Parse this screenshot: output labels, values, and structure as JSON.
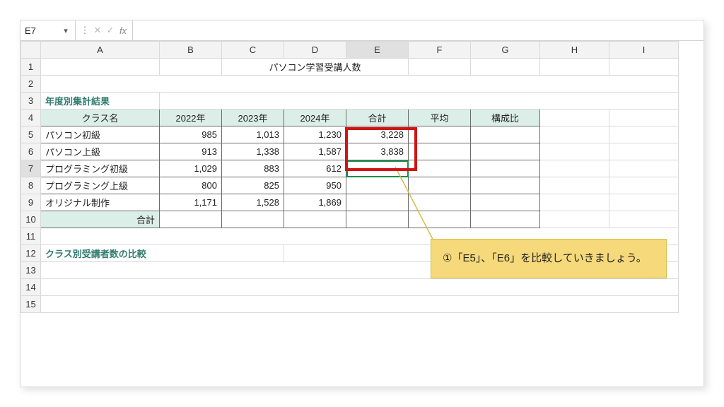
{
  "namebox": {
    "ref": "E7"
  },
  "formula": "",
  "columns": [
    "A",
    "B",
    "C",
    "D",
    "E",
    "F",
    "G",
    "H",
    "I"
  ],
  "rows": [
    "1",
    "2",
    "3",
    "4",
    "5",
    "6",
    "7",
    "8",
    "9",
    "10",
    "11",
    "12",
    "13",
    "14",
    "15"
  ],
  "title": "パソコン学習受講人数",
  "section1": "年度別集計結果",
  "headers": {
    "class": "クラス名",
    "y2022": "2022年",
    "y2023": "2023年",
    "y2024": "2024年",
    "total": "合計",
    "avg": "平均",
    "ratio": "構成比"
  },
  "data": [
    {
      "name": "パソコン初級",
      "y22": "985",
      "y23": "1,013",
      "y24": "1,230",
      "total": "3,228"
    },
    {
      "name": "パソコン上級",
      "y22": "913",
      "y23": "1,338",
      "y24": "1,587",
      "total": "3,838"
    },
    {
      "name": "プログラミング初級",
      "y22": "1,029",
      "y23": "883",
      "y24": "612",
      "total": ""
    },
    {
      "name": "プログラミング上級",
      "y22": "800",
      "y23": "825",
      "y24": "950",
      "total": ""
    },
    {
      "name": "オリジナル制作",
      "y22": "1,171",
      "y23": "1,528",
      "y24": "1,869",
      "total": ""
    }
  ],
  "total_label": "合計",
  "section2": "クラス別受講者数の比較",
  "callout": "①「E5」、「E6」を比較していきましょう。"
}
